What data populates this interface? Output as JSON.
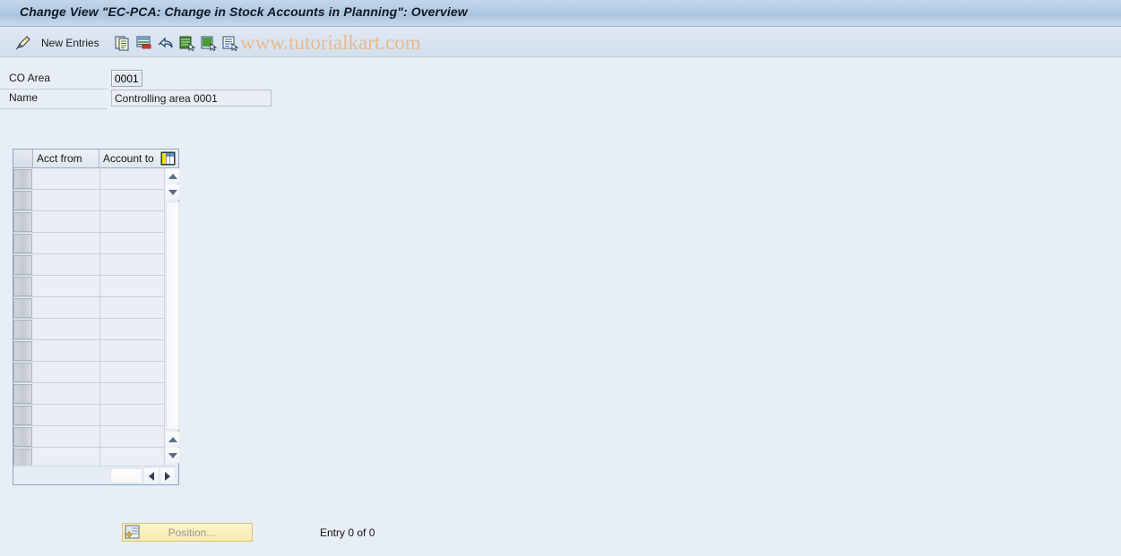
{
  "window": {
    "title": "Change View \"EC-PCA: Change in Stock Accounts in Planning\": Overview"
  },
  "toolbar": {
    "new_entries_label": "New Entries",
    "watermark": "www.tutorialkart.com",
    "icons": [
      {
        "name": "pencil-edit-icon",
        "title": "Display/Change"
      },
      {
        "name": "copy-icon",
        "title": "Copy As"
      },
      {
        "name": "delete-row-icon",
        "title": "Delete"
      },
      {
        "name": "undo-icon",
        "title": "Undo Change"
      },
      {
        "name": "select-all-icon",
        "title": "Select All"
      },
      {
        "name": "deselect-all-icon",
        "title": "Deselect All"
      },
      {
        "name": "details-icon",
        "title": "Details"
      }
    ]
  },
  "form": {
    "co_area_label": "CO Area",
    "co_area_value": "0001",
    "name_label": "Name",
    "name_value": "Controlling area 0001"
  },
  "table": {
    "columns": [
      {
        "key": "select",
        "label": ""
      },
      {
        "key": "acct_from",
        "label": "Acct from"
      },
      {
        "key": "account_to",
        "label": "Account to"
      }
    ],
    "config_icon": "table-settings-icon",
    "rows": [],
    "empty_row_count": 14
  },
  "footer": {
    "position_button_label": "Position...",
    "position_button_icon": "position-icon",
    "entry_status": "Entry 0 of 0"
  },
  "colors": {
    "page_background": "#e8eef5",
    "title_bar": "#b3cae4",
    "toolbar": "#d9e4f0",
    "watermark": "#e9b98c",
    "table_border": "#8aa5c2",
    "position_button": "#f9ebb0"
  }
}
